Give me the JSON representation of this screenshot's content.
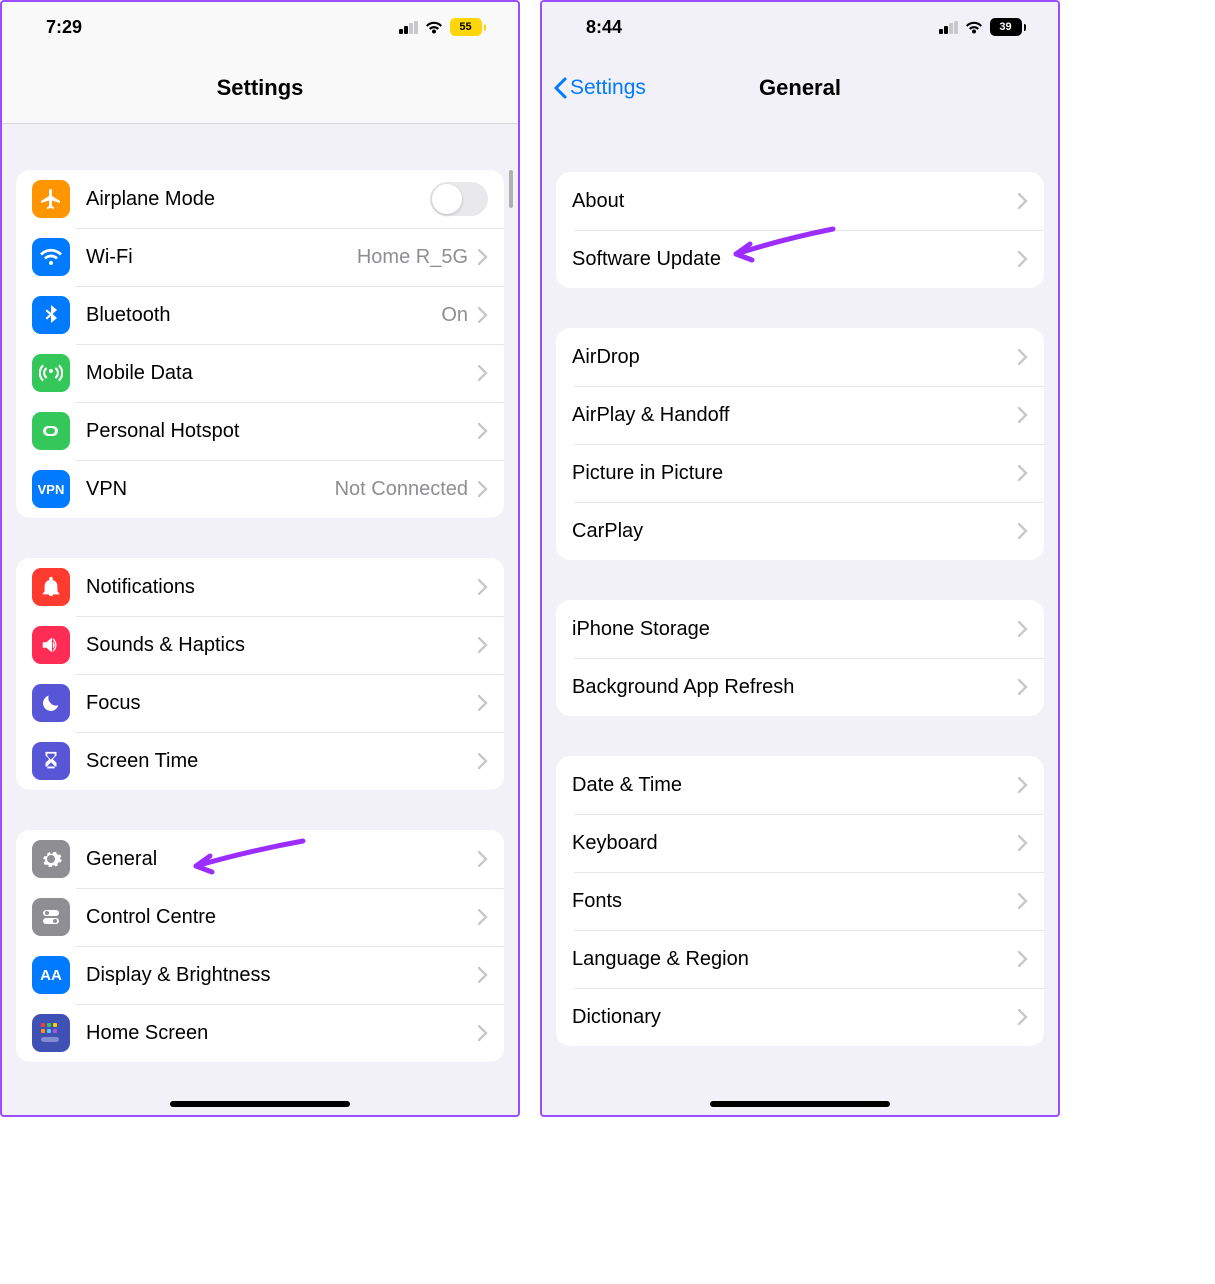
{
  "left": {
    "status": {
      "time": "7:29",
      "battery": "55"
    },
    "nav": {
      "title": "Settings"
    },
    "groups": [
      {
        "rows": [
          {
            "icon": "airplane",
            "bg": "orange",
            "label": "Airplane Mode",
            "toggle": true
          },
          {
            "icon": "wifi",
            "bg": "blue",
            "label": "Wi-Fi",
            "detail": "Home R_5G",
            "chev": true
          },
          {
            "icon": "bluetooth",
            "bg": "blue",
            "label": "Bluetooth",
            "detail": "On",
            "chev": true
          },
          {
            "icon": "antenna",
            "bg": "green",
            "label": "Mobile Data",
            "chev": true
          },
          {
            "icon": "link",
            "bg": "green",
            "label": "Personal Hotspot",
            "chev": true
          },
          {
            "icon": "vpn",
            "bg": "blue",
            "label": "VPN",
            "detail": "Not Connected",
            "chev": true
          }
        ]
      },
      {
        "rows": [
          {
            "icon": "bell",
            "bg": "red",
            "label": "Notifications",
            "chev": true
          },
          {
            "icon": "speaker",
            "bg": "pink",
            "label": "Sounds & Haptics",
            "chev": true
          },
          {
            "icon": "moon",
            "bg": "indigo",
            "label": "Focus",
            "chev": true
          },
          {
            "icon": "hourglass",
            "bg": "indigo",
            "label": "Screen Time",
            "chev": true
          }
        ]
      },
      {
        "rows": [
          {
            "icon": "gear",
            "bg": "gray",
            "label": "General",
            "chev": true,
            "arrow": true
          },
          {
            "icon": "switches",
            "bg": "gray",
            "label": "Control Centre",
            "chev": true
          },
          {
            "icon": "aa",
            "bg": "blue",
            "label": "Display & Brightness",
            "chev": true
          },
          {
            "icon": "home",
            "bg": "home",
            "label": "Home Screen",
            "chev": true
          }
        ]
      }
    ]
  },
  "right": {
    "status": {
      "time": "8:44",
      "battery": "39"
    },
    "nav": {
      "back": "Settings",
      "title": "General"
    },
    "groups": [
      {
        "rows": [
          {
            "label": "About",
            "chev": true
          },
          {
            "label": "Software Update",
            "chev": true,
            "arrow": true
          }
        ]
      },
      {
        "rows": [
          {
            "label": "AirDrop",
            "chev": true
          },
          {
            "label": "AirPlay & Handoff",
            "chev": true
          },
          {
            "label": "Picture in Picture",
            "chev": true
          },
          {
            "label": "CarPlay",
            "chev": true
          }
        ]
      },
      {
        "rows": [
          {
            "label": "iPhone Storage",
            "chev": true
          },
          {
            "label": "Background App Refresh",
            "chev": true
          }
        ]
      },
      {
        "rows": [
          {
            "label": "Date & Time",
            "chev": true
          },
          {
            "label": "Keyboard",
            "chev": true
          },
          {
            "label": "Fonts",
            "chev": true
          },
          {
            "label": "Language & Region",
            "chev": true
          },
          {
            "label": "Dictionary",
            "chev": true
          }
        ]
      }
    ]
  }
}
